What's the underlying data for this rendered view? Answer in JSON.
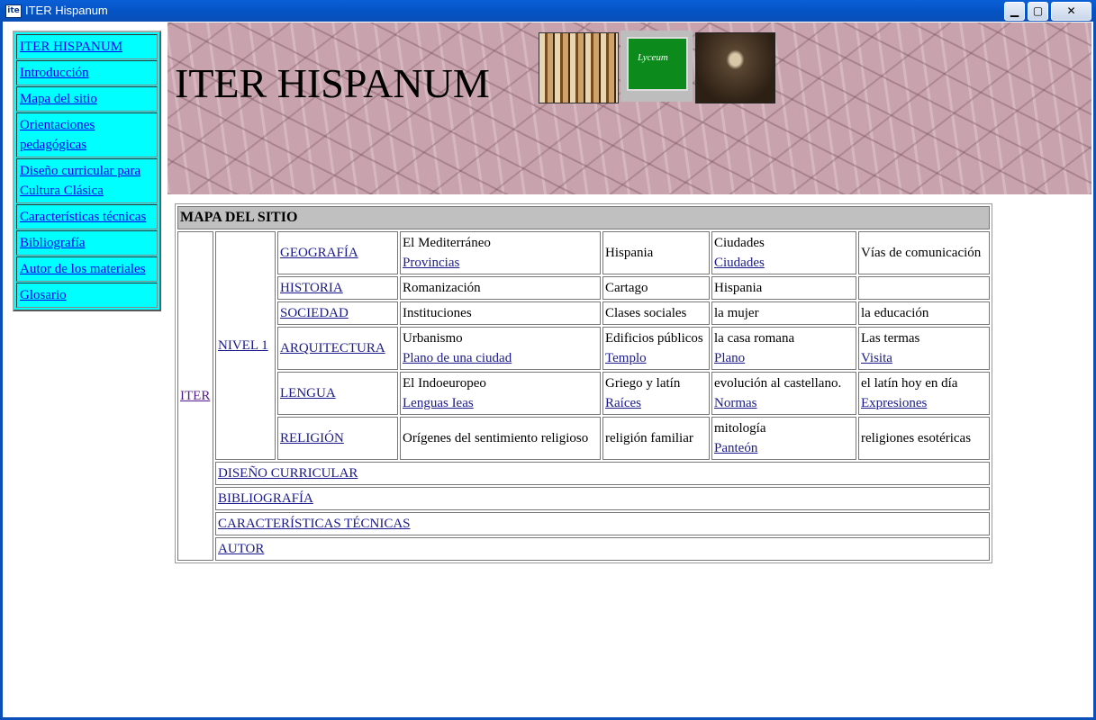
{
  "window": {
    "title": "ITER Hispanum",
    "icon_text": "ite",
    "controls": [
      "minimize",
      "maximize",
      "close"
    ],
    "control_glyphs": {
      "minimize": "▁",
      "maximize": "▢",
      "close": "✕"
    }
  },
  "sidebar": {
    "items": [
      {
        "label": "ITER HISPANUM"
      },
      {
        "label": "Introducción"
      },
      {
        "label": "Mapa del sitio"
      },
      {
        "label": "Orientaciones pedagógicas"
      },
      {
        "label": "Diseño curricular para Cultura Clásica"
      },
      {
        "label": "Características técnicas"
      },
      {
        "label": "Bibliografía"
      },
      {
        "label": "Autor de los materiales"
      },
      {
        "label": "Glosario"
      }
    ]
  },
  "banner": {
    "title": "ITER HISPANUM",
    "lyceum_text": "Lyceum",
    "images": [
      "books-image",
      "lyceum-image",
      "corridor-image"
    ]
  },
  "sitemap": {
    "heading": "MAPA DEL SITIO",
    "root": "ITER",
    "level": "NIVEL 1",
    "rows": {
      "geografia": {
        "topic": "GEOGRAFÍA",
        "c1": "El Mediterráneo",
        "c1_link": "Provincias",
        "c2": "Hispania",
        "c3": "Ciudades",
        "c3_link": "Ciudades",
        "c4": "Vías de comunicación"
      },
      "historia": {
        "topic": "HISTORIA",
        "c1": "Romanización",
        "c2": "Cartago",
        "c3": "Hispania",
        "c4": ""
      },
      "sociedad": {
        "topic": "SOCIEDAD",
        "c1": "Instituciones",
        "c2": "Clases sociales",
        "c3": "la mujer",
        "c4": "la educación"
      },
      "arquitectura": {
        "topic": "ARQUITECTURA",
        "c1": "Urbanismo",
        "c1_link": "Plano de una ciudad",
        "c2": "Edificios públicos",
        "c2_link": "Templo",
        "c3": "la casa romana",
        "c3_link": "Plano",
        "c4": "Las termas",
        "c4_link": "Visita"
      },
      "lengua": {
        "topic": "LENGUA",
        "c1": "El Indoeuropeo",
        "c1_link": "Lenguas Ieas",
        "c2": "Griego y latín",
        "c2_link": "Raíces",
        "c3": "evolución al castellano.",
        "c3_link": "Normas",
        "c4": "el latín hoy en día",
        "c4_link": "Expresiones"
      },
      "religion": {
        "topic": "RELIGIÓN",
        "c1": "Orígenes del sentimiento religioso",
        "c2": "religión familiar",
        "c3": "mitología",
        "c3_link": "Panteón",
        "c4": "religiones esotéricas"
      }
    },
    "footer_links": {
      "diseno": "DISEÑO CURRICULAR",
      "bibliografia": "BIBLIOGRAFÍA",
      "caracteristicas": "CARACTERÍSTICAS TÉCNICAS",
      "autor": "AUTOR"
    }
  }
}
